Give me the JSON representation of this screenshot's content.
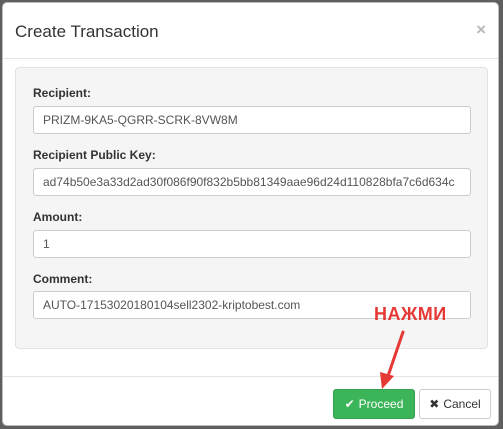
{
  "dialog": {
    "title": "Create Transaction",
    "close_icon": "×"
  },
  "form": {
    "recipient": {
      "label": "Recipient:",
      "value": "PRIZM-9KA5-QGRR-SCRK-8VW8M"
    },
    "public_key": {
      "label": "Recipient Public Key:",
      "value": "ad74b50e3a33d2ad30f086f90f832b5bb81349aae96d24d110828bfa7c6d634c"
    },
    "amount": {
      "label": "Amount:",
      "value": "1"
    },
    "comment": {
      "label": "Comment:",
      "value": "AUTO-17153020180104sell2302-kriptobest.com"
    }
  },
  "buttons": {
    "proceed": {
      "icon": "✔",
      "label": "Proceed"
    },
    "cancel": {
      "icon": "✖",
      "label": "Cancel"
    }
  },
  "annotation": {
    "text": "НАЖМИ",
    "color": "#e53935"
  },
  "colors": {
    "proceed_bg": "#3cb55a",
    "annotation": "#e53935"
  }
}
